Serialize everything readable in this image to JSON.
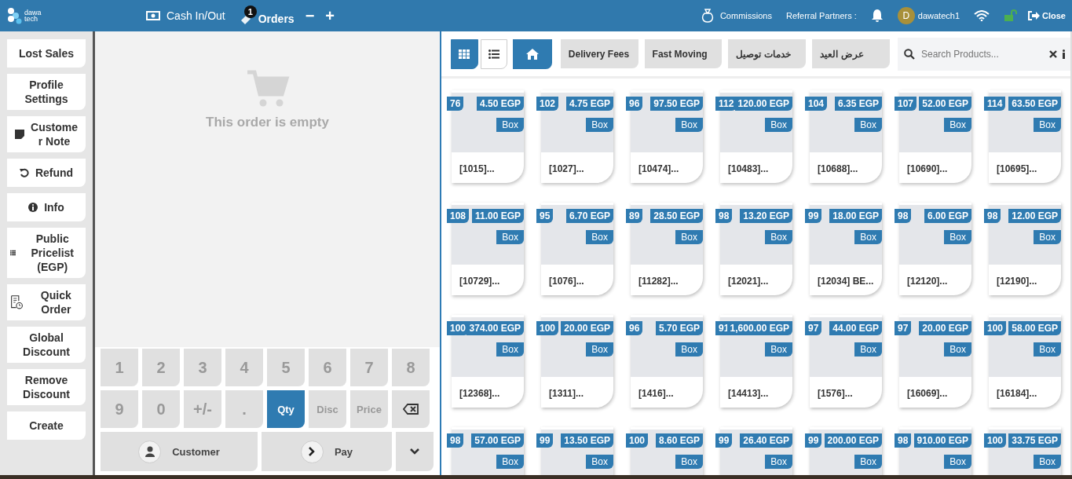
{
  "topbar": {
    "logo": [
      "dawa",
      "tech"
    ],
    "cash": "Cash In/Out",
    "orders": {
      "label": "Orders",
      "count": "1"
    },
    "minus": "−",
    "plus": "+",
    "commissions": "Commissions",
    "referral": "Referral Partners :",
    "avatar": "D",
    "user": "dawatech1",
    "close": "Close"
  },
  "sidebar": [
    {
      "label": "Lost Sales",
      "kind": "plain"
    },
    {
      "label": "Profile Settings",
      "kind": "plain"
    },
    {
      "label": "Customer Note",
      "kind": "note"
    },
    {
      "label": "Refund",
      "kind": "refund"
    },
    {
      "label": "Info",
      "kind": "info"
    },
    {
      "label": "Public Pricelist (EGP)",
      "kind": "pricelist"
    },
    {
      "label": "Quick Order",
      "kind": "order"
    },
    {
      "label": "Global Discount",
      "kind": "plain"
    },
    {
      "label": "Remove Discount",
      "kind": "plain"
    },
    {
      "label": "Create",
      "kind": "plain"
    }
  ],
  "order": {
    "empty": "This order is empty"
  },
  "numpad": [
    {
      "kind": "key",
      "label": "1",
      "selected": false
    },
    {
      "kind": "key",
      "label": "2",
      "selected": false
    },
    {
      "kind": "key",
      "label": "3",
      "selected": false
    },
    {
      "kind": "key",
      "label": "4",
      "selected": false
    },
    {
      "kind": "key",
      "label": "5",
      "selected": false
    },
    {
      "kind": "key",
      "label": "6",
      "selected": false
    },
    {
      "kind": "key",
      "label": "7",
      "selected": false
    },
    {
      "kind": "key",
      "label": "8",
      "selected": false
    },
    {
      "kind": "key",
      "label": "9",
      "selected": false
    },
    {
      "kind": "key",
      "label": "0",
      "selected": false
    },
    {
      "kind": "key",
      "label": "+/-",
      "selected": false
    },
    {
      "kind": "key",
      "label": ".",
      "selected": false
    },
    {
      "kind": "mode",
      "label": "Qty",
      "selected": true
    },
    {
      "kind": "mode",
      "label": "Disc",
      "selected": false
    },
    {
      "kind": "mode",
      "label": "Price",
      "selected": false
    },
    {
      "kind": "backspace",
      "selected": false
    }
  ],
  "actions": {
    "customer": "Customer",
    "pay": "Pay"
  },
  "toolbar": {
    "views": [
      {
        "kind": "grid",
        "selected": true
      },
      {
        "kind": "list",
        "selected": false
      }
    ],
    "categories": [
      "Delivery Fees",
      "Fast Moving",
      "خدمات توصيل",
      "عرض العيد"
    ],
    "search": {
      "placeholder": "Search Products..."
    }
  },
  "products": [
    {
      "stock": "76",
      "price": "4.50 EGP",
      "unit": "Box",
      "name": "[1015]..."
    },
    {
      "stock": "102",
      "price": "4.75 EGP",
      "unit": "Box",
      "name": "[1027]..."
    },
    {
      "stock": "96",
      "price": "97.50 EGP",
      "unit": "Box",
      "name": "[10474]..."
    },
    {
      "stock": "112",
      "price": "120.00 EGP",
      "unit": "Box",
      "name": "[10483]..."
    },
    {
      "stock": "104",
      "price": "6.35 EGP",
      "unit": "Box",
      "name": "[10688]..."
    },
    {
      "stock": "107",
      "price": "52.00 EGP",
      "unit": "Box",
      "name": "[10690]..."
    },
    {
      "stock": "114",
      "price": "63.50 EGP",
      "unit": "Box",
      "name": "[10695]..."
    },
    {
      "stock": "108",
      "price": "11.00 EGP",
      "unit": "Box",
      "name": "[10729]..."
    },
    {
      "stock": "95",
      "price": "6.70 EGP",
      "unit": "Box",
      "name": "[1076]..."
    },
    {
      "stock": "89",
      "price": "28.50 EGP",
      "unit": "Box",
      "name": "[11282]..."
    },
    {
      "stock": "98",
      "price": "13.20 EGP",
      "unit": "Box",
      "name": "[12021]..."
    },
    {
      "stock": "99",
      "price": "18.00 EGP",
      "unit": "Box",
      "name": "[12034] BE..."
    },
    {
      "stock": "98",
      "price": "6.00 EGP",
      "unit": "Box",
      "name": "[12120]..."
    },
    {
      "stock": "98",
      "price": "12.00 EGP",
      "unit": "Box",
      "name": "[12190]..."
    },
    {
      "stock": "100",
      "price": "374.00 EGP",
      "unit": "Box",
      "name": "[12368]..."
    },
    {
      "stock": "100",
      "price": "20.00 EGP",
      "unit": "Box",
      "name": "[1311]..."
    },
    {
      "stock": "96",
      "price": "5.70 EGP",
      "unit": "Box",
      "name": "[1416]..."
    },
    {
      "stock": "91",
      "price": "1,600.00 EGP",
      "unit": "Box",
      "name": "[14413]..."
    },
    {
      "stock": "97",
      "price": "44.00 EGP",
      "unit": "Box",
      "name": "[1576]..."
    },
    {
      "stock": "97",
      "price": "20.00 EGP",
      "unit": "Box",
      "name": "[16069]..."
    },
    {
      "stock": "100",
      "price": "58.00 EGP",
      "unit": "Box",
      "name": "[16184]..."
    },
    {
      "stock": "98",
      "price": "57.00 EGP",
      "unit": "Box"
    },
    {
      "stock": "99",
      "price": "13.50 EGP",
      "unit": "Box"
    },
    {
      "stock": "100",
      "price": "8.60 EGP",
      "unit": "Box"
    },
    {
      "stock": "99",
      "price": "26.40 EGP",
      "unit": "Box"
    },
    {
      "stock": "99",
      "price": "200.00 EGP",
      "unit": "Box"
    },
    {
      "stock": "98",
      "price": "910.00 EGP",
      "unit": "Box"
    },
    {
      "stock": "100",
      "price": "33.75 EGP",
      "unit": "Box"
    }
  ]
}
